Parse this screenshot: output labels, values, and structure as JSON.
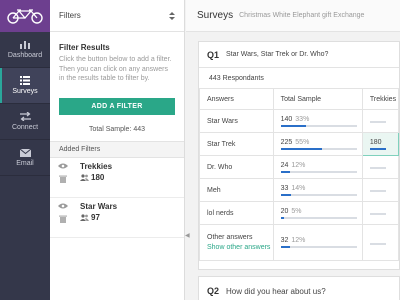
{
  "nav": {
    "items": [
      {
        "label": "Dashboard",
        "icon": "bar-chart-icon",
        "active": false
      },
      {
        "label": "Surveys",
        "icon": "list-icon",
        "active": true
      },
      {
        "label": "Connect",
        "icon": "swap-arrows-icon",
        "active": false
      },
      {
        "label": "Email",
        "icon": "envelope-icon",
        "active": false
      }
    ],
    "logo_icon": "tandem-bicycle-icon",
    "colors": {
      "nav_bg": "#34374a",
      "logo_bg": "#6d3f8f",
      "accent": "#2aa79b"
    }
  },
  "filters": {
    "header_label": "Filters",
    "sort_icon": "up-down-caret-icon",
    "section_title": "Filter Results",
    "description": "Click the button below to add a filter. Then you can click on any answers in the results table to filter by.",
    "add_button": "ADD A FILTER",
    "total_sample": "Total Sample: 443",
    "added_label": "Added Filters",
    "added": [
      {
        "name": "Trekkies",
        "count": "180"
      },
      {
        "name": "Star Wars",
        "count": "97"
      }
    ],
    "collapse_icon": "caret-left-icon"
  },
  "main": {
    "title": "Surveys",
    "subtitle": "Christmas White Elephant gift Exchange"
  },
  "question1": {
    "number": "Q1",
    "text": "Star Wars, Star Trek or Dr. Who?",
    "respondents": "443 Respondants",
    "columns": [
      "Answers",
      "Total Sample",
      "Trekkies"
    ],
    "rows": [
      {
        "answer": "Star Wars",
        "count": "140",
        "pct": "33%",
        "share": 0.33,
        "trek": "",
        "trek_share": 0.0
      },
      {
        "answer": "Star Trek",
        "count": "225",
        "pct": "55%",
        "share": 0.55,
        "trek": "180",
        "trek_share": 1.0
      },
      {
        "answer": "Dr. Who",
        "count": "24",
        "pct": "12%",
        "share": 0.12,
        "trek": "",
        "trek_share": 0.0
      },
      {
        "answer": "Meh",
        "count": "33",
        "pct": "14%",
        "share": 0.14,
        "trek": "",
        "trek_share": 0.0
      },
      {
        "answer": "lol nerds",
        "count": "20",
        "pct": "5%",
        "share": 0.05,
        "trek": "",
        "trek_share": 0.0
      },
      {
        "answer": "Other answers",
        "count": "32",
        "pct": "12%",
        "share": 0.12,
        "trek": "",
        "trek_share": 0.0,
        "link": "Show other answers"
      }
    ],
    "colors": {
      "bar": "#2a6fc8",
      "track": "#d9dde3",
      "highlight": "#eaf6f2"
    }
  },
  "question2": {
    "number": "Q2",
    "text": "How did you hear about us?"
  }
}
